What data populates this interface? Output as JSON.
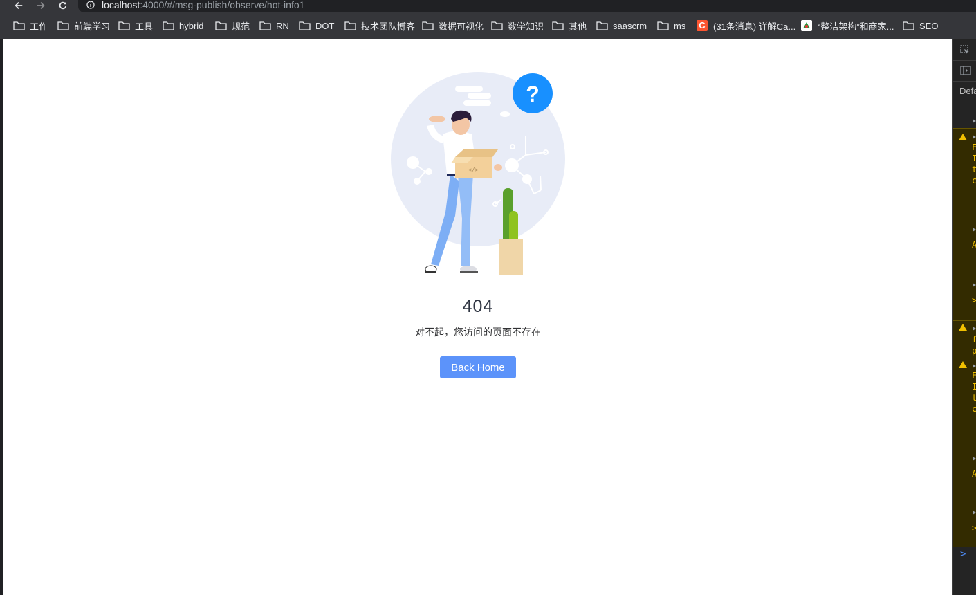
{
  "browser": {
    "url_host": "localhost",
    "url_rest": ":4000/#/msg-publish/observe/hot-info1"
  },
  "bookmarks": [
    {
      "label": "工作",
      "icon": "folder-icon"
    },
    {
      "label": "前端学习",
      "icon": "folder-icon"
    },
    {
      "label": "工具",
      "icon": "folder-icon"
    },
    {
      "label": "hybrid",
      "icon": "folder-icon"
    },
    {
      "label": "规范",
      "icon": "folder-icon"
    },
    {
      "label": "RN",
      "icon": "folder-icon"
    },
    {
      "label": "DOT",
      "icon": "folder-icon"
    },
    {
      "label": "技术团队博客",
      "icon": "folder-icon"
    },
    {
      "label": "数据可视化",
      "icon": "folder-icon"
    },
    {
      "label": "数学知识",
      "icon": "folder-icon"
    },
    {
      "label": "其他",
      "icon": "folder-icon"
    },
    {
      "label": "saascrm",
      "icon": "folder-icon"
    },
    {
      "label": "ms",
      "icon": "folder-icon"
    },
    {
      "label": "(31条消息) 详解Ca...",
      "icon": "csdn-favicon"
    },
    {
      "label": "“整洁架构”和商家...",
      "icon": "site-favicon"
    },
    {
      "label": "SEO",
      "icon": "folder-icon"
    }
  ],
  "error_page": {
    "code": "404",
    "message": "对不起，您访问的页面不存在",
    "back_button": "Back Home"
  },
  "devtools": {
    "default_label": "Defa",
    "warn_texts": [
      "F",
      "I",
      "t",
      "c",
      "A",
      ">",
      "f",
      "p",
      "F",
      "I",
      "t",
      "c",
      "A",
      ">"
    ],
    "prompt": ">"
  },
  "colors": {
    "primary_button": "#5c93fa",
    "question_badge": "#1890ff",
    "warning": "#f0c000"
  }
}
